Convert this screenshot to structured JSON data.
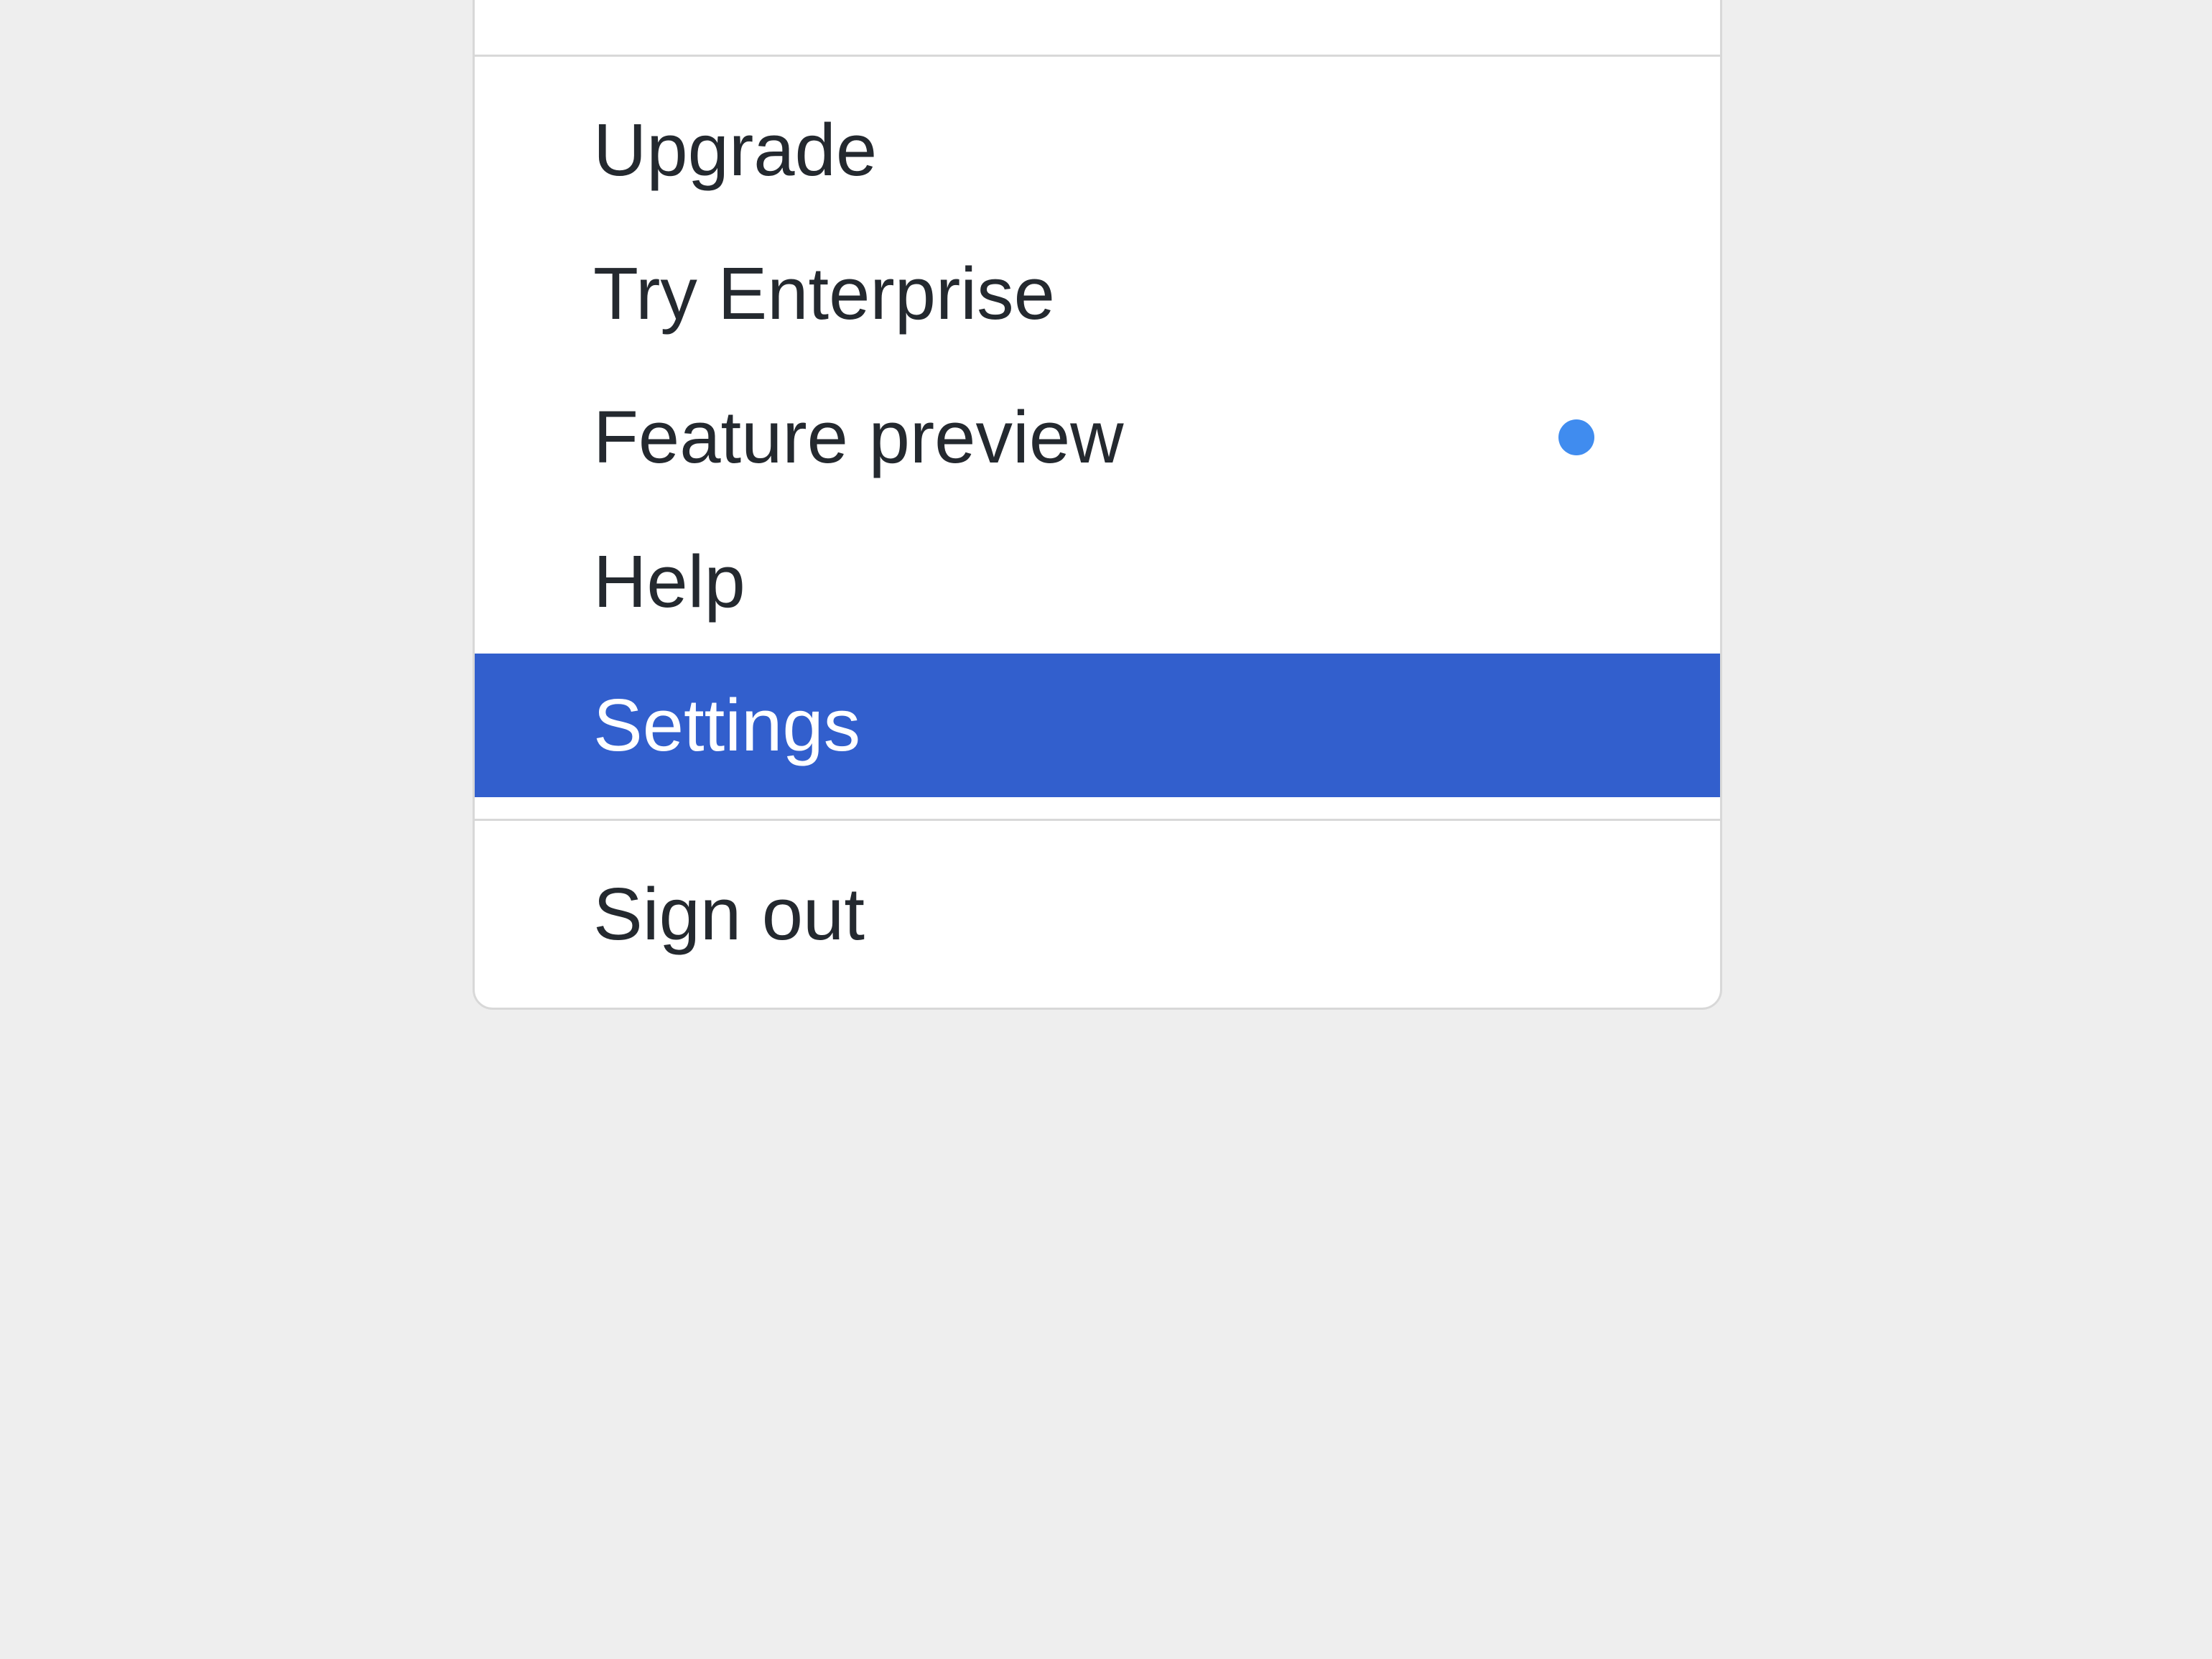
{
  "menu": {
    "items": [
      {
        "label": "Upgrade",
        "active": false,
        "hasIndicator": false
      },
      {
        "label": "Try Enterprise",
        "active": false,
        "hasIndicator": false
      },
      {
        "label": "Feature preview",
        "active": false,
        "hasIndicator": true
      },
      {
        "label": "Help",
        "active": false,
        "hasIndicator": false
      },
      {
        "label": "Settings",
        "active": true,
        "hasIndicator": false
      }
    ],
    "signout": {
      "label": "Sign out"
    }
  },
  "colors": {
    "activeBackground": "#325fcd",
    "indicatorDot": "#408cef",
    "border": "#d8d8d8",
    "text": "#24292f",
    "background": "#eeeeee"
  }
}
